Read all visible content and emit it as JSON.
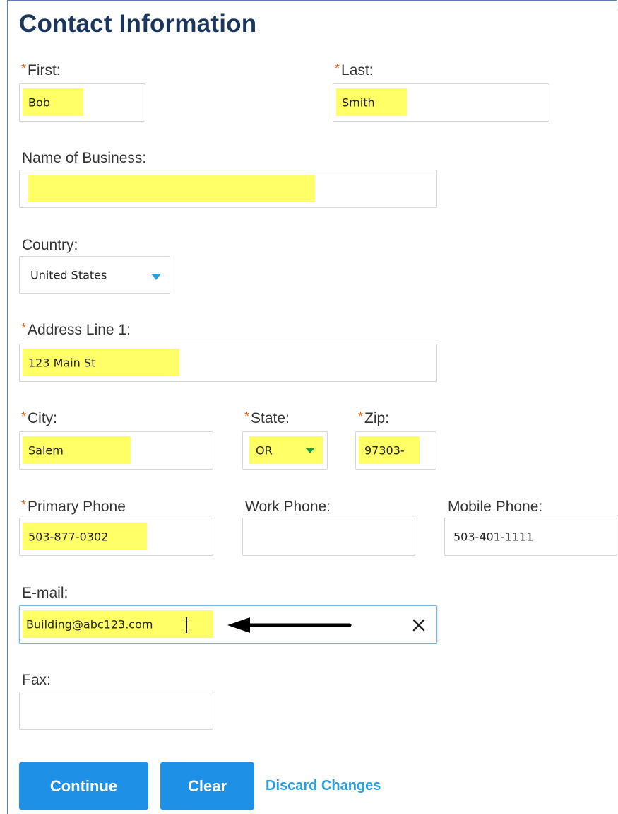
{
  "page_title": "Contact Information",
  "required_mark": "*",
  "first": {
    "label": "First:",
    "value": "Bob"
  },
  "last": {
    "label": "Last:",
    "value": "Smith"
  },
  "business": {
    "label": "Name of Business:",
    "value": ""
  },
  "country": {
    "label": "Country:",
    "value": "United States"
  },
  "address1": {
    "label": "Address Line 1:",
    "value": "123 Main St"
  },
  "city": {
    "label": "City:",
    "value": "Salem"
  },
  "state": {
    "label": "State:",
    "value": "OR"
  },
  "zip": {
    "label": "Zip:",
    "value": "97303-"
  },
  "primary_phone": {
    "label": "Primary Phone",
    "value": "503-877-0302"
  },
  "work_phone": {
    "label": "Work Phone:",
    "value": ""
  },
  "mobile_phone": {
    "label": "Mobile Phone:",
    "value": "503-401-1111"
  },
  "email": {
    "label": "E-mail:",
    "value": "Building@abc123.com",
    "clear_icon": "close-icon"
  },
  "fax": {
    "label": "Fax:",
    "value": ""
  },
  "buttons": {
    "continue": "Continue",
    "clear": "Clear",
    "discard": "Discard Changes"
  },
  "colors": {
    "highlight": "#ffff66",
    "accent": "#1e90e6",
    "required": "#e06a1b",
    "title": "#1b365d"
  }
}
